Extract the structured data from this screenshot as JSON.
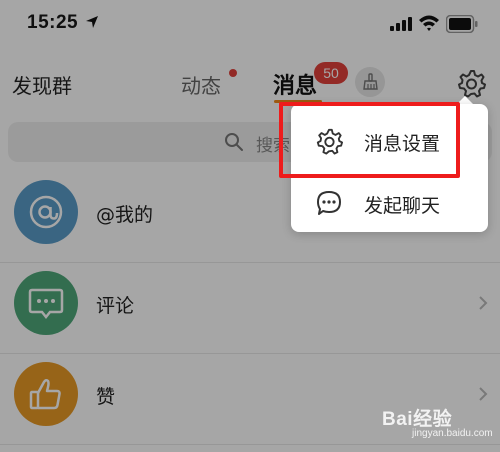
{
  "status_bar": {
    "time": "15:25"
  },
  "top_nav": {
    "left_label": "发现群",
    "tabs": [
      {
        "label": "动态",
        "has_dot": true
      },
      {
        "label": "消息",
        "active": true,
        "badge": "50"
      }
    ]
  },
  "search": {
    "placeholder": "搜索"
  },
  "list": {
    "items": [
      {
        "label": "@我的",
        "icon": "at-icon",
        "color": "#5a9cc8"
      },
      {
        "label": "评论",
        "icon": "comment-icon",
        "color": "#4fa87a"
      },
      {
        "label": "赞",
        "icon": "thumbs-up-icon",
        "color": "#e89a26"
      }
    ]
  },
  "popup_menu": {
    "items": [
      {
        "label": "消息设置",
        "icon": "gear-icon"
      },
      {
        "label": "发起聊天",
        "icon": "chat-bubble-icon"
      }
    ]
  },
  "watermark": {
    "text": "Bai经验",
    "sub": "jingyan.baidu.com"
  },
  "colors": {
    "accent": "#f08a1c",
    "badge": "#e2413b",
    "highlight": "#ee1c1c"
  }
}
